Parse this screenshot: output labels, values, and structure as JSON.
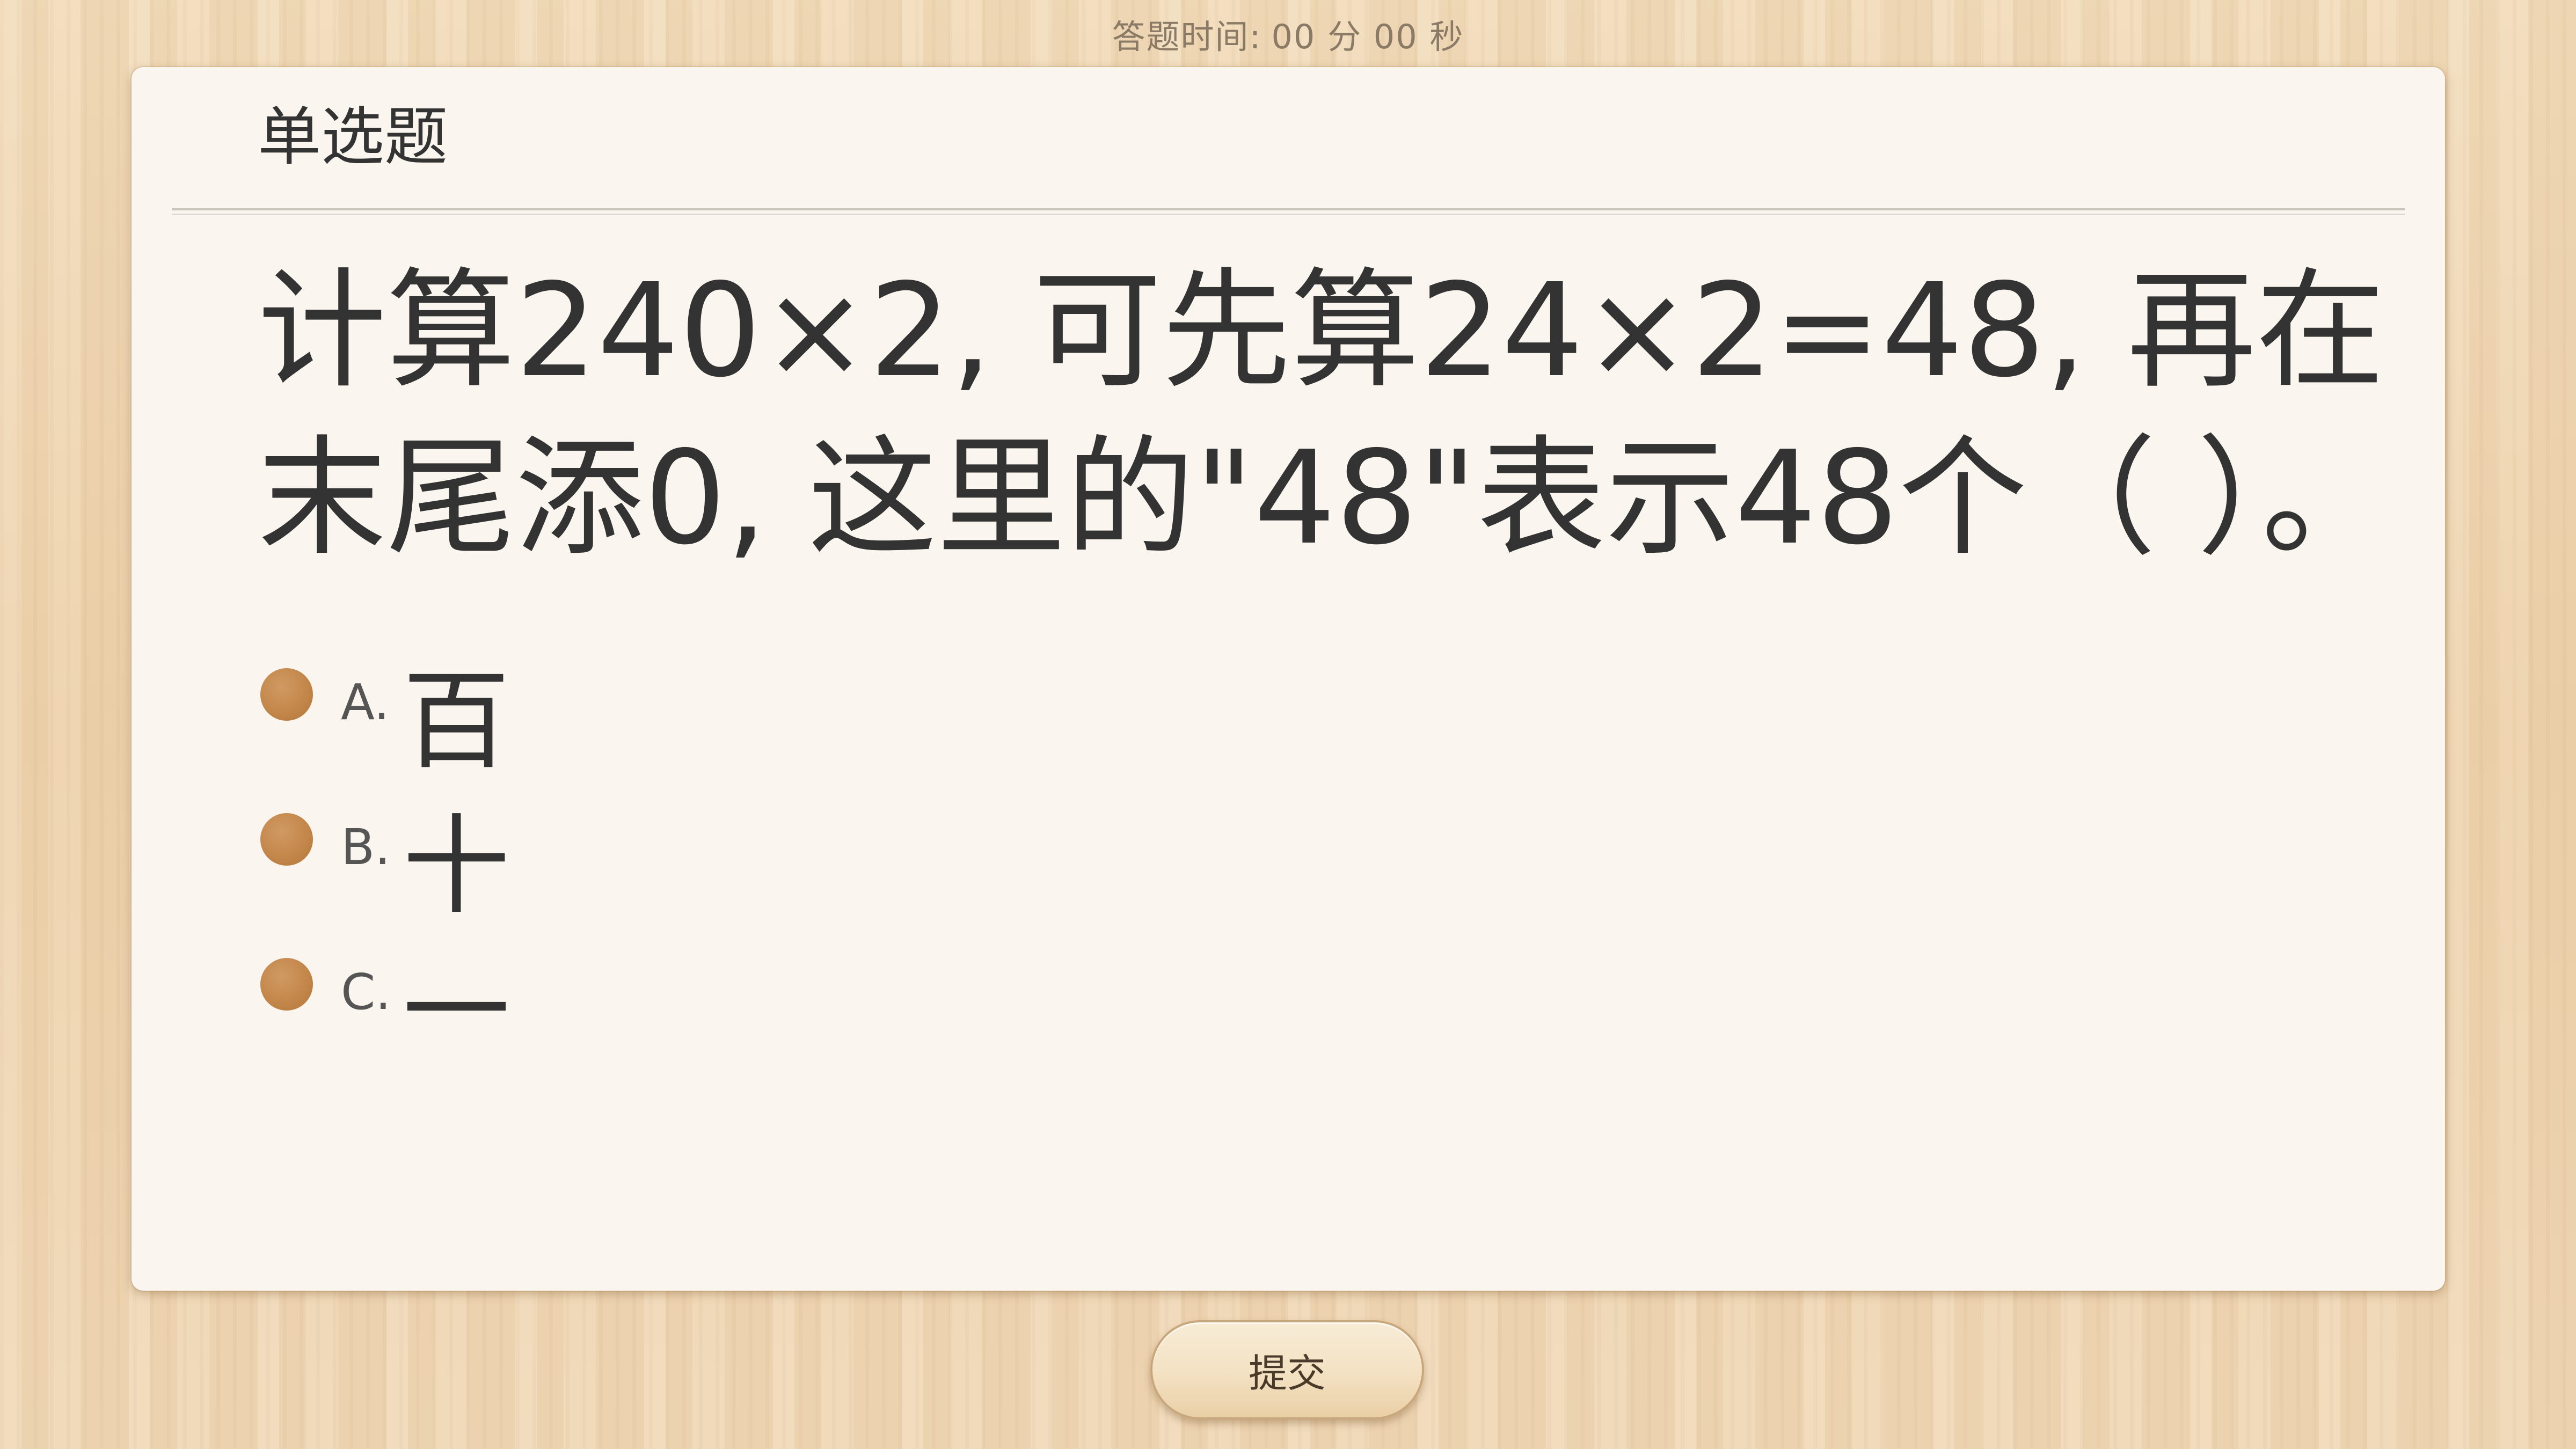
{
  "header": {
    "timer_label": "答题时间:",
    "minutes": "00",
    "minutes_unit": "分",
    "seconds": "00",
    "seconds_unit": "秒"
  },
  "question": {
    "type_label": "单选题",
    "text": "计算240×2, 可先算24×2=48, 再在末尾添0, 这里的\"48\"表示48个（ ）。",
    "options": [
      {
        "letter": "A.",
        "text": "百"
      },
      {
        "letter": "B.",
        "text": "十"
      },
      {
        "letter": "C.",
        "text": "一"
      }
    ]
  },
  "footer": {
    "submit_label": "提交"
  },
  "colors": {
    "background_wood": "#efd6b2",
    "card": "#faf6ef",
    "option_dot": "#c28549",
    "text": "#333333"
  }
}
